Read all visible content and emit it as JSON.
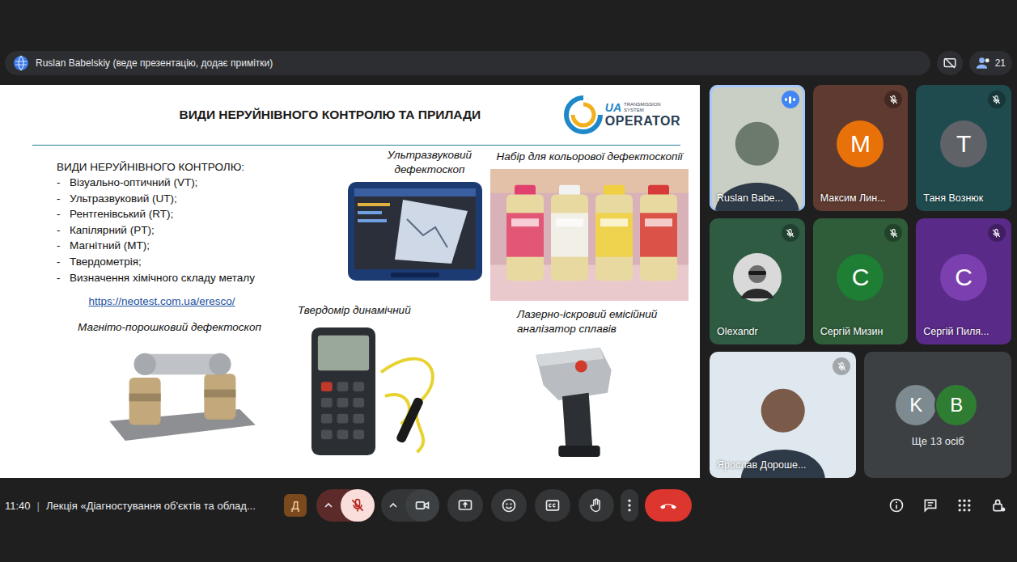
{
  "presenter_bar": {
    "text": "Ruslan Babelskiy (веде презентацію, додає примітки)",
    "participant_count": "21"
  },
  "slide": {
    "title": "ВИДИ НЕРУЙНІВНОГО КОНТРОЛЮ ТА ПРИЛАДИ",
    "logo": {
      "prefix": "UA",
      "line1": "TRANSMISSION",
      "line2": "SYSTEM",
      "main": "OPERATOR"
    },
    "list_title": "ВИДИ НЕРУЙНІВНОГО КОНТРОЛЮ:",
    "bullet": "-",
    "list": [
      "Візуально-оптичний (VT);",
      "Ультразвуковий (UT);",
      "Рентгенівський (RT);",
      "Капілярний (PT);",
      "Магнітний (MT);",
      "Твердометрія;",
      "Визначення хімічного складу металу"
    ],
    "link": "https://neotest.com.ua/eresco/",
    "devices": [
      {
        "caption": "Ультразвуковий дефектоскоп",
        "kind": "ultrasonic"
      },
      {
        "caption": "Набір для кольорової дефектоскопії",
        "kind": "dye"
      },
      {
        "caption": "Твердомір динамічний",
        "kind": "hardness"
      },
      {
        "caption": "Лазерно-іскровий емісійний аналізатор сплавів",
        "kind": "spark"
      },
      {
        "caption": "Магніто-порошковий дефектоскоп",
        "kind": "magnetic"
      }
    ]
  },
  "participants": [
    {
      "name": "Ruslan Babe...",
      "kind": "video",
      "initial": "",
      "color": "#6b7a6a",
      "background": "#c9cfc4",
      "muted": false,
      "speaking": true
    },
    {
      "name": "Максим Лин...",
      "kind": "initial",
      "initial": "M",
      "color": "#e8710a",
      "background": "#5e3a30",
      "muted": true,
      "speaking": false
    },
    {
      "name": "Таня Вознюк",
      "kind": "initial",
      "initial": "T",
      "color": "#5f6368",
      "background": "#1f4b4f",
      "muted": true,
      "speaking": false
    },
    {
      "name": "Olexandr",
      "kind": "photo",
      "initial": "",
      "color": "#d9d9d9",
      "background": "#2e5b42",
      "muted": true,
      "speaking": false
    },
    {
      "name": "Сергій Мизин",
      "kind": "initial",
      "initial": "C",
      "color": "#1e7e34",
      "background": "#2f5d3a",
      "muted": true,
      "speaking": false
    },
    {
      "name": "Сергій Пиля...",
      "kind": "initial",
      "initial": "C",
      "color": "#7b3fb0",
      "background": "#5a2a88",
      "muted": true,
      "speaking": false
    },
    {
      "name": "Ярослав Дороше...",
      "kind": "video",
      "initial": "",
      "color": "#7a5a48",
      "background": "#dfe8ee",
      "muted": true,
      "speaking": false
    }
  ],
  "more_tile": {
    "label": "Ще 13 осіб",
    "avatars": [
      {
        "initial": "K",
        "color": "#7d8a90"
      },
      {
        "initial": "B",
        "color": "#2e7d32"
      }
    ]
  },
  "bottom_bar": {
    "time": "11:40",
    "separator": "|",
    "meeting_title": "Лекція «Діагностування об'єктів та облад...",
    "app_badge": "Д",
    "mic_muted": true,
    "camera_off": false
  }
}
